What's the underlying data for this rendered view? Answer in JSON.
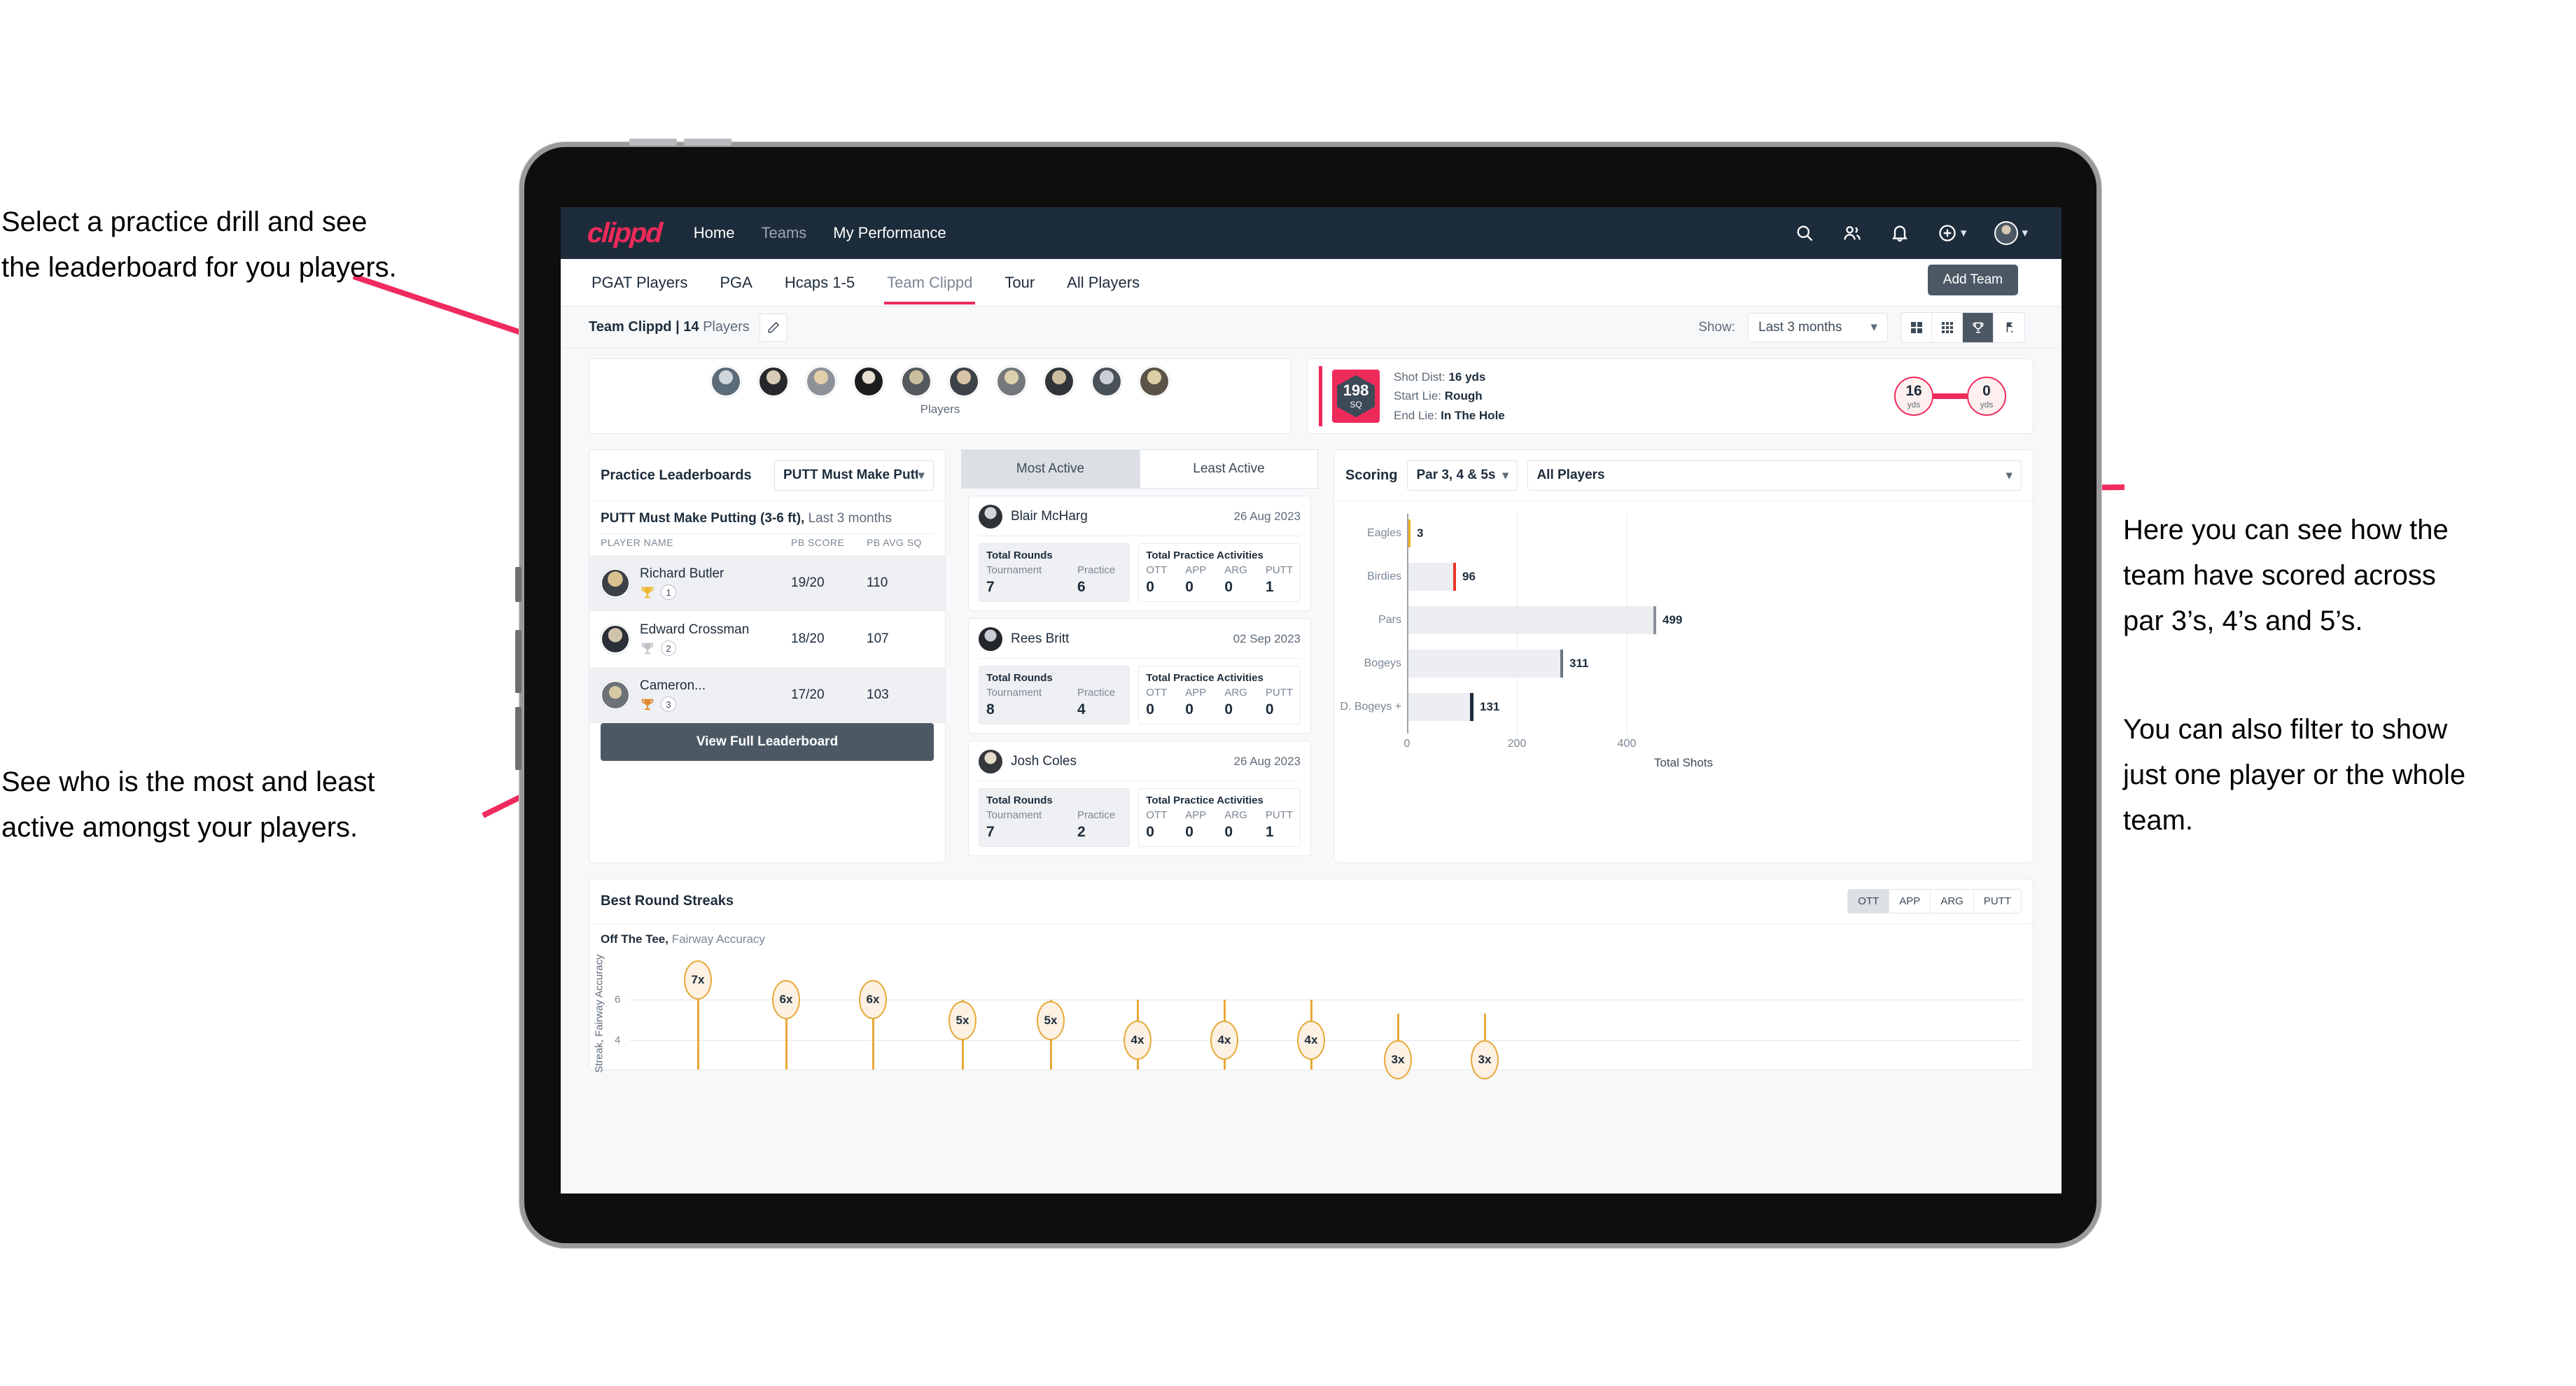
{
  "annotations": {
    "top_left": "Select a practice drill and see\nthe leaderboard for you players.",
    "bottom_left": "See who is the most and least\nactive amongst your players.",
    "right_1": "Here you can see how the\nteam have scored across\npar 3’s, 4’s and 5’s.",
    "right_2": "You can also filter to show\njust one player or the whole\nteam."
  },
  "navbar": {
    "logo": "clippd",
    "links": [
      {
        "label": "Home",
        "dim": false
      },
      {
        "label": "Teams",
        "dim": true
      },
      {
        "label": "My Performance",
        "dim": false
      }
    ],
    "icons": [
      "search-icon",
      "people-icon",
      "bell-icon",
      "plus-circle-icon",
      "avatar"
    ]
  },
  "tabs": {
    "items": [
      {
        "label": "PGAT Players",
        "active": false
      },
      {
        "label": "PGA",
        "active": false
      },
      {
        "label": "Hcaps 1-5",
        "active": false
      },
      {
        "label": "Team Clippd",
        "active": true
      },
      {
        "label": "Tour",
        "active": false
      },
      {
        "label": "All Players",
        "active": false
      }
    ],
    "add_team_label": "Add Team"
  },
  "subheader": {
    "team_name": "Team Clippd",
    "player_count": "14",
    "players_word": "Players",
    "separator": " | ",
    "show_label": "Show:",
    "period_value": "Last 3 months",
    "view_toggles": [
      "grid-large-icon",
      "grid-small-icon",
      "trophy-icon",
      "flag-icon"
    ],
    "active_toggle_index": 2
  },
  "players_card": {
    "caption": "Players",
    "avatar_count": 10
  },
  "shot_card": {
    "sq_value": "198",
    "sq_unit": "SQ",
    "lines": [
      {
        "label": "Shot Dist:",
        "value": "16 yds"
      },
      {
        "label": "Start Lie:",
        "value": "Rough"
      },
      {
        "label": "End Lie:",
        "value": "In The Hole"
      }
    ],
    "start_distance": "16",
    "start_unit": "yds",
    "end_distance": "0",
    "end_unit": "yds"
  },
  "leaderboard": {
    "title": "Practice Leaderboards",
    "drill_select": "PUTT Must Make Putting ...",
    "subtitle_bold": "PUTT Must Make Putting (3-6 ft),",
    "subtitle_rest": " Last 3 months",
    "columns": [
      "PLAYER NAME",
      "PB SCORE",
      "PB AVG SQ"
    ],
    "rows": [
      {
        "name": "Richard Butler",
        "rank": "1",
        "trophy": "gold",
        "score": "19/20",
        "sq": "110"
      },
      {
        "name": "Edward Crossman",
        "rank": "2",
        "trophy": "silver",
        "score": "18/20",
        "sq": "107"
      },
      {
        "name": "Cameron...",
        "rank": "3",
        "trophy": "bronze",
        "score": "17/20",
        "sq": "103"
      }
    ],
    "view_full_label": "View Full Leaderboard"
  },
  "activity": {
    "tabs": [
      {
        "label": "Most Active",
        "active": true
      },
      {
        "label": "Least Active",
        "active": false
      }
    ],
    "rounds_title": "Total Rounds",
    "practice_title": "Total Practice Activities",
    "rounds_keys": [
      "Tournament",
      "Practice"
    ],
    "practice_keys": [
      "OTT",
      "APP",
      "ARG",
      "PUTT"
    ],
    "cards": [
      {
        "name": "Blair McHarg",
        "date": "26 Aug 2023",
        "rounds": [
          "7",
          "6"
        ],
        "practice": [
          "0",
          "0",
          "0",
          "1"
        ]
      },
      {
        "name": "Rees Britt",
        "date": "02 Sep 2023",
        "rounds": [
          "8",
          "4"
        ],
        "practice": [
          "0",
          "0",
          "0",
          "0"
        ]
      },
      {
        "name": "Josh Coles",
        "date": "26 Aug 2023",
        "rounds": [
          "7",
          "2"
        ],
        "practice": [
          "0",
          "0",
          "0",
          "1"
        ]
      }
    ]
  },
  "scoring": {
    "title": "Scoring",
    "par_select": "Par 3, 4 & 5s",
    "player_select": "All Players"
  },
  "streaks": {
    "title": "Best Round Streaks",
    "segments": [
      {
        "label": "OTT",
        "active": true
      },
      {
        "label": "APP",
        "active": false
      },
      {
        "label": "ARG",
        "active": false
      },
      {
        "label": "PUTT",
        "active": false
      }
    ],
    "sub_bold": "Off The Tee,",
    "sub_rest": " Fairway Accuracy"
  },
  "chart_data": [
    {
      "type": "bar",
      "orientation": "horizontal",
      "title": "Scoring",
      "categories": [
        "Eagles",
        "Birdies",
        "Pars",
        "Bogeys",
        "D. Bogeys +"
      ],
      "values": [
        3,
        96,
        499,
        311,
        131
      ],
      "bar_tip_colors": [
        "#f0ad1f",
        "#e8392b",
        "#8a9099",
        "#6c757d",
        "#1d2c3b"
      ],
      "xlabel": "Total Shots",
      "ylabel": "",
      "xticks": [
        0,
        200,
        400
      ],
      "xlim": [
        0,
        530
      ],
      "grid": true,
      "legend": false
    },
    {
      "type": "scatter",
      "title": "Best Round Streaks",
      "subtitle": "Off The Tee, Fairway Accuracy",
      "ylabel": "Streak, Fairway Accuracy",
      "xlabel": "",
      "yticks": [
        4,
        6
      ],
      "ylim": [
        2,
        8
      ],
      "grid": true,
      "legend": false,
      "point_labels": [
        "7x",
        "6x",
        "6x",
        "5x",
        "5x",
        "4x",
        "4x",
        "4x",
        "3x",
        "3x"
      ],
      "values": [
        7,
        6,
        6,
        5,
        5,
        4,
        4,
        4,
        3,
        3
      ],
      "marker_fill": "#fcf1e2",
      "marker_stroke": "#e8a838"
    }
  ]
}
